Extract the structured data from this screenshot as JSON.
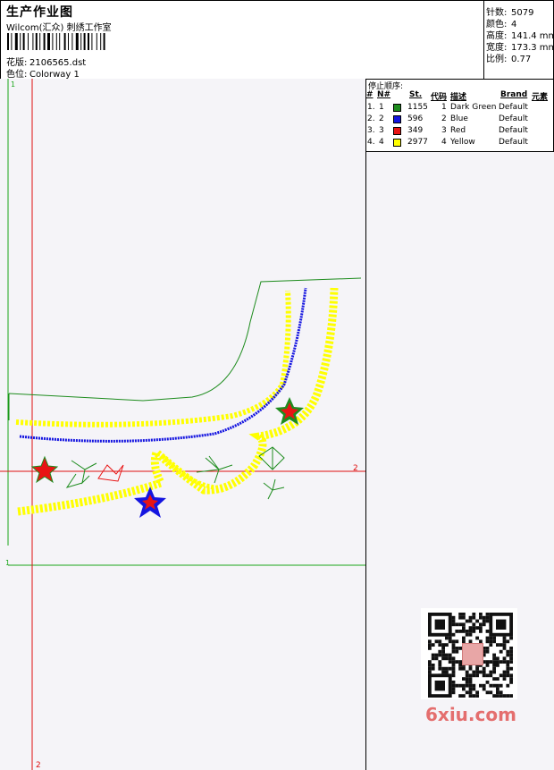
{
  "header": {
    "title": "生产作业图",
    "studio": "Wilcom(汇众) 刺绣工作室",
    "design_label": "花版:",
    "design_file": "2106565.dst",
    "color_label": "色位:",
    "colorway": "Colorway 1"
  },
  "stats": {
    "stitches_label": "针数:",
    "stitches": "5079",
    "colors_label": "颜色:",
    "colors": "4",
    "height_label": "高度:",
    "height": "141.4 mm",
    "width_label": "宽度:",
    "width": "173.3 mm",
    "scale_label": "比例:",
    "scale": "0.77"
  },
  "stop_sequence": {
    "caption": "停止顺序:",
    "headers": [
      "#",
      "N#",
      "St.",
      "代码",
      "描述",
      "Brand",
      "元素"
    ],
    "rows": [
      {
        "idx": "1.",
        "n": "1",
        "color": "#1e8c1e",
        "st": "1155",
        "code": "1",
        "desc": "Dark Green",
        "brand": "Default"
      },
      {
        "idx": "2.",
        "n": "2",
        "color": "#1414e0",
        "st": "596",
        "code": "2",
        "desc": "Blue",
        "brand": "Default"
      },
      {
        "idx": "3.",
        "n": "3",
        "color": "#e81414",
        "st": "349",
        "code": "3",
        "desc": "Red",
        "brand": "Default"
      },
      {
        "idx": "4.",
        "n": "4",
        "color": "#ffff00",
        "st": "2977",
        "code": "4",
        "desc": "Yellow",
        "brand": "Default"
      }
    ]
  },
  "guides": {
    "v_label_top": "1",
    "h_label_left": "1",
    "h_label_right": "2",
    "v_label_bottom": "2"
  },
  "watermark": {
    "text": "6xiu.com",
    "seal_text": "汇众"
  },
  "colors": {
    "grid_green": "#1aa61a",
    "guide_red": "#e01010",
    "canvas_bg": "#f5f4f8"
  }
}
